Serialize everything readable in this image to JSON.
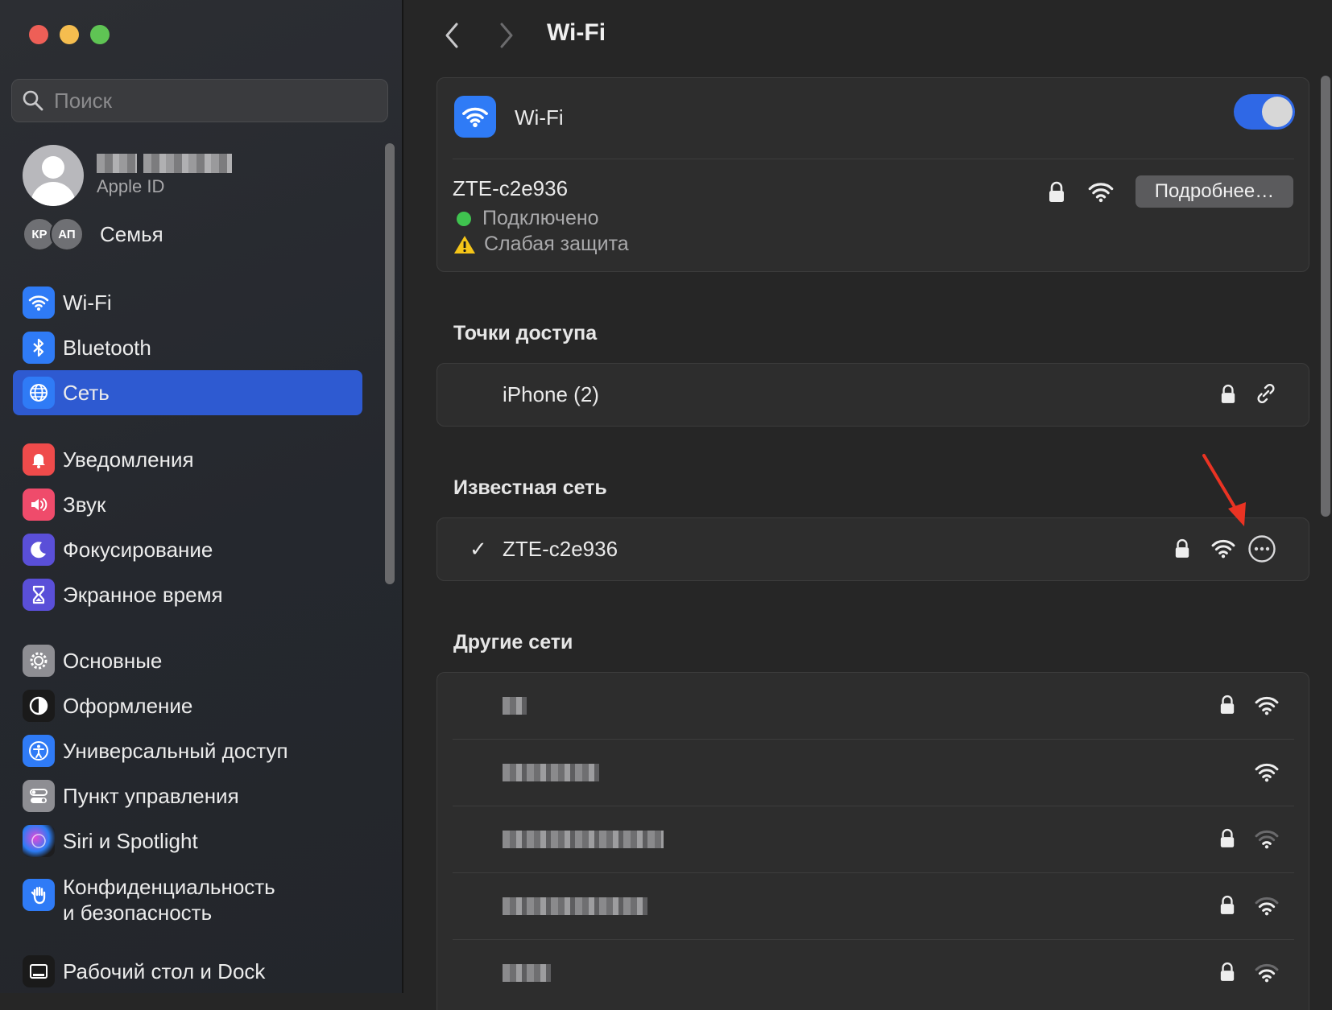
{
  "sidebar": {
    "search_placeholder": "Поиск",
    "profile": {
      "subtitle": "Apple ID"
    },
    "family": {
      "label": "Семья",
      "avatars": [
        "КР",
        "АП"
      ]
    },
    "items": [
      {
        "label": "Wi-Fi",
        "icon": "wifi-icon",
        "color": "#2f7bf6"
      },
      {
        "label": "Bluetooth",
        "icon": "bluetooth-icon",
        "color": "#2f7bf6"
      },
      {
        "label": "Сеть",
        "icon": "globe-icon",
        "color": "#2f7bf6",
        "active": true
      },
      {
        "label": "Уведомления",
        "icon": "bell-icon",
        "color": "#ef4b4b"
      },
      {
        "label": "Звук",
        "icon": "speaker-icon",
        "color": "#ef4b6b"
      },
      {
        "label": "Фокусирование",
        "icon": "moon-icon",
        "color": "#5a4fd8"
      },
      {
        "label": "Экранное время",
        "icon": "hourglass-icon",
        "color": "#5a4fd8"
      },
      {
        "label": "Основные",
        "icon": "gear-icon",
        "color": "#8e8e93"
      },
      {
        "label": "Оформление",
        "icon": "appearance-icon",
        "color": "#1a1a1a"
      },
      {
        "label": "Универсальный доступ",
        "icon": "accessibility-icon",
        "color": "#2f7bf6"
      },
      {
        "label": "Пункт управления",
        "icon": "control-center-icon",
        "color": "#8e8e93"
      },
      {
        "label": "Siri и Spotlight",
        "icon": "siri-icon",
        "color": "#1a1a1a"
      },
      {
        "label": "Конфиденциальность\nи безопасность",
        "icon": "hand-icon",
        "color": "#2f7bf6"
      },
      {
        "label": "Рабочий стол и Dock",
        "icon": "dock-icon",
        "color": "#1a1a1a"
      }
    ]
  },
  "main": {
    "title": "Wi-Fi",
    "wifi_card": {
      "label": "Wi-Fi",
      "enabled": true,
      "current_network": "ZTE-c2e936",
      "status_connected": "Подключено",
      "status_warning": "Слабая защита",
      "details_button": "Подробнее…"
    },
    "hotspots": {
      "title": "Точки доступа",
      "items": [
        {
          "name": "iPhone (2)"
        }
      ]
    },
    "known": {
      "title": "Известная сеть",
      "items": [
        {
          "name": "ZTE-c2e936",
          "check": "✓"
        }
      ]
    },
    "other": {
      "title": "Другие сети"
    }
  },
  "accent": "#2e5ad1"
}
